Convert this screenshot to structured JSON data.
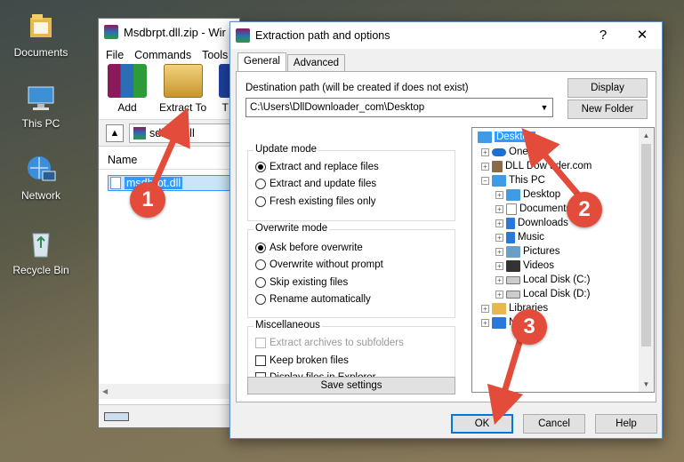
{
  "desktop": {
    "icons": [
      {
        "label": "Documents",
        "icon": "folder-documents-icon"
      },
      {
        "label": "This PC",
        "icon": "computer-icon"
      },
      {
        "label": "Network",
        "icon": "network-icon"
      },
      {
        "label": "Recycle Bin",
        "icon": "recycle-bin-icon"
      }
    ]
  },
  "winrar": {
    "title": "Msdbrpt.dll.zip - Wir",
    "menu": [
      "File",
      "Commands",
      "Tools"
    ],
    "toolbar": {
      "add": "Add",
      "extract_to": "Extract To",
      "third": "T"
    },
    "address": "sdbrpt.dll",
    "column_name": "Name",
    "file": "msdbrpt.dll"
  },
  "dialog": {
    "title": "Extraction path and options",
    "help_glyph": "?",
    "close_glyph": "✕",
    "tabs": [
      "General",
      "Advanced"
    ],
    "dest_label": "Destination path (will be created if does not exist)",
    "dest_value": "C:\\Users\\DllDownloader_com\\Desktop",
    "display_btn": "Display",
    "new_folder_btn": "New Folder",
    "update_mode": {
      "title": "Update mode",
      "options": [
        "Extract and replace files",
        "Extract and update files",
        "Fresh existing files only"
      ],
      "selected": 0
    },
    "overwrite_mode": {
      "title": "Overwrite mode",
      "options": [
        "Ask before overwrite",
        "Overwrite without prompt",
        "Skip existing files",
        "Rename automatically"
      ],
      "selected": 0
    },
    "misc": {
      "title": "Miscellaneous",
      "options": [
        "Extract archives to subfolders",
        "Keep broken files",
        "Display files in Explorer"
      ]
    },
    "save_settings": "Save settings",
    "tree": [
      {
        "label": "Desktop"
      },
      {
        "label": "OneDr"
      },
      {
        "label": "DLL Dow      ader.com"
      },
      {
        "label": "This PC"
      },
      {
        "label": "Desktop"
      },
      {
        "label": "Documents"
      },
      {
        "label": "Downloads"
      },
      {
        "label": "Music"
      },
      {
        "label": "Pictures"
      },
      {
        "label": "Videos"
      },
      {
        "label": "Local Disk (C:)"
      },
      {
        "label": "Local Disk (D:)"
      },
      {
        "label": "Libraries"
      },
      {
        "label": "Ne"
      }
    ],
    "ok": "OK",
    "cancel": "Cancel",
    "help": "Help"
  },
  "annotations": {
    "step1": "1",
    "step2": "2",
    "step3": "3",
    "color": "#e34b3a"
  }
}
